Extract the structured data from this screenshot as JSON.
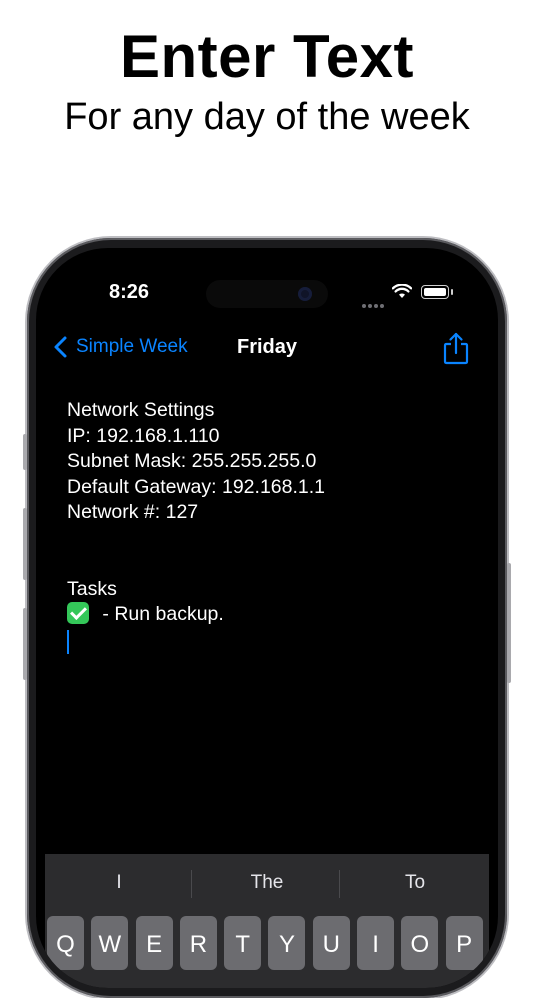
{
  "promo": {
    "headline": "Enter Text",
    "subhead": "For any day of the week"
  },
  "status_bar": {
    "time": "8:26"
  },
  "nav": {
    "back_label": "Simple Week",
    "title": "Friday"
  },
  "note": {
    "lines": [
      "Network Settings",
      "IP: 192.168.1.110",
      "Subnet Mask: 255.255.255.0",
      "Default Gateway: 192.168.1.1",
      "Network #: 127"
    ],
    "tasks_header": "Tasks",
    "task_text": " - Run backup."
  },
  "keyboard": {
    "suggestions": [
      "I",
      "The",
      "To"
    ],
    "top_row": [
      "Q",
      "W",
      "E",
      "R",
      "T",
      "Y",
      "U",
      "I",
      "O",
      "P"
    ]
  },
  "colors": {
    "accent": "#0a84ff",
    "checkmark": "#34c759",
    "screen_bg": "#000000"
  }
}
